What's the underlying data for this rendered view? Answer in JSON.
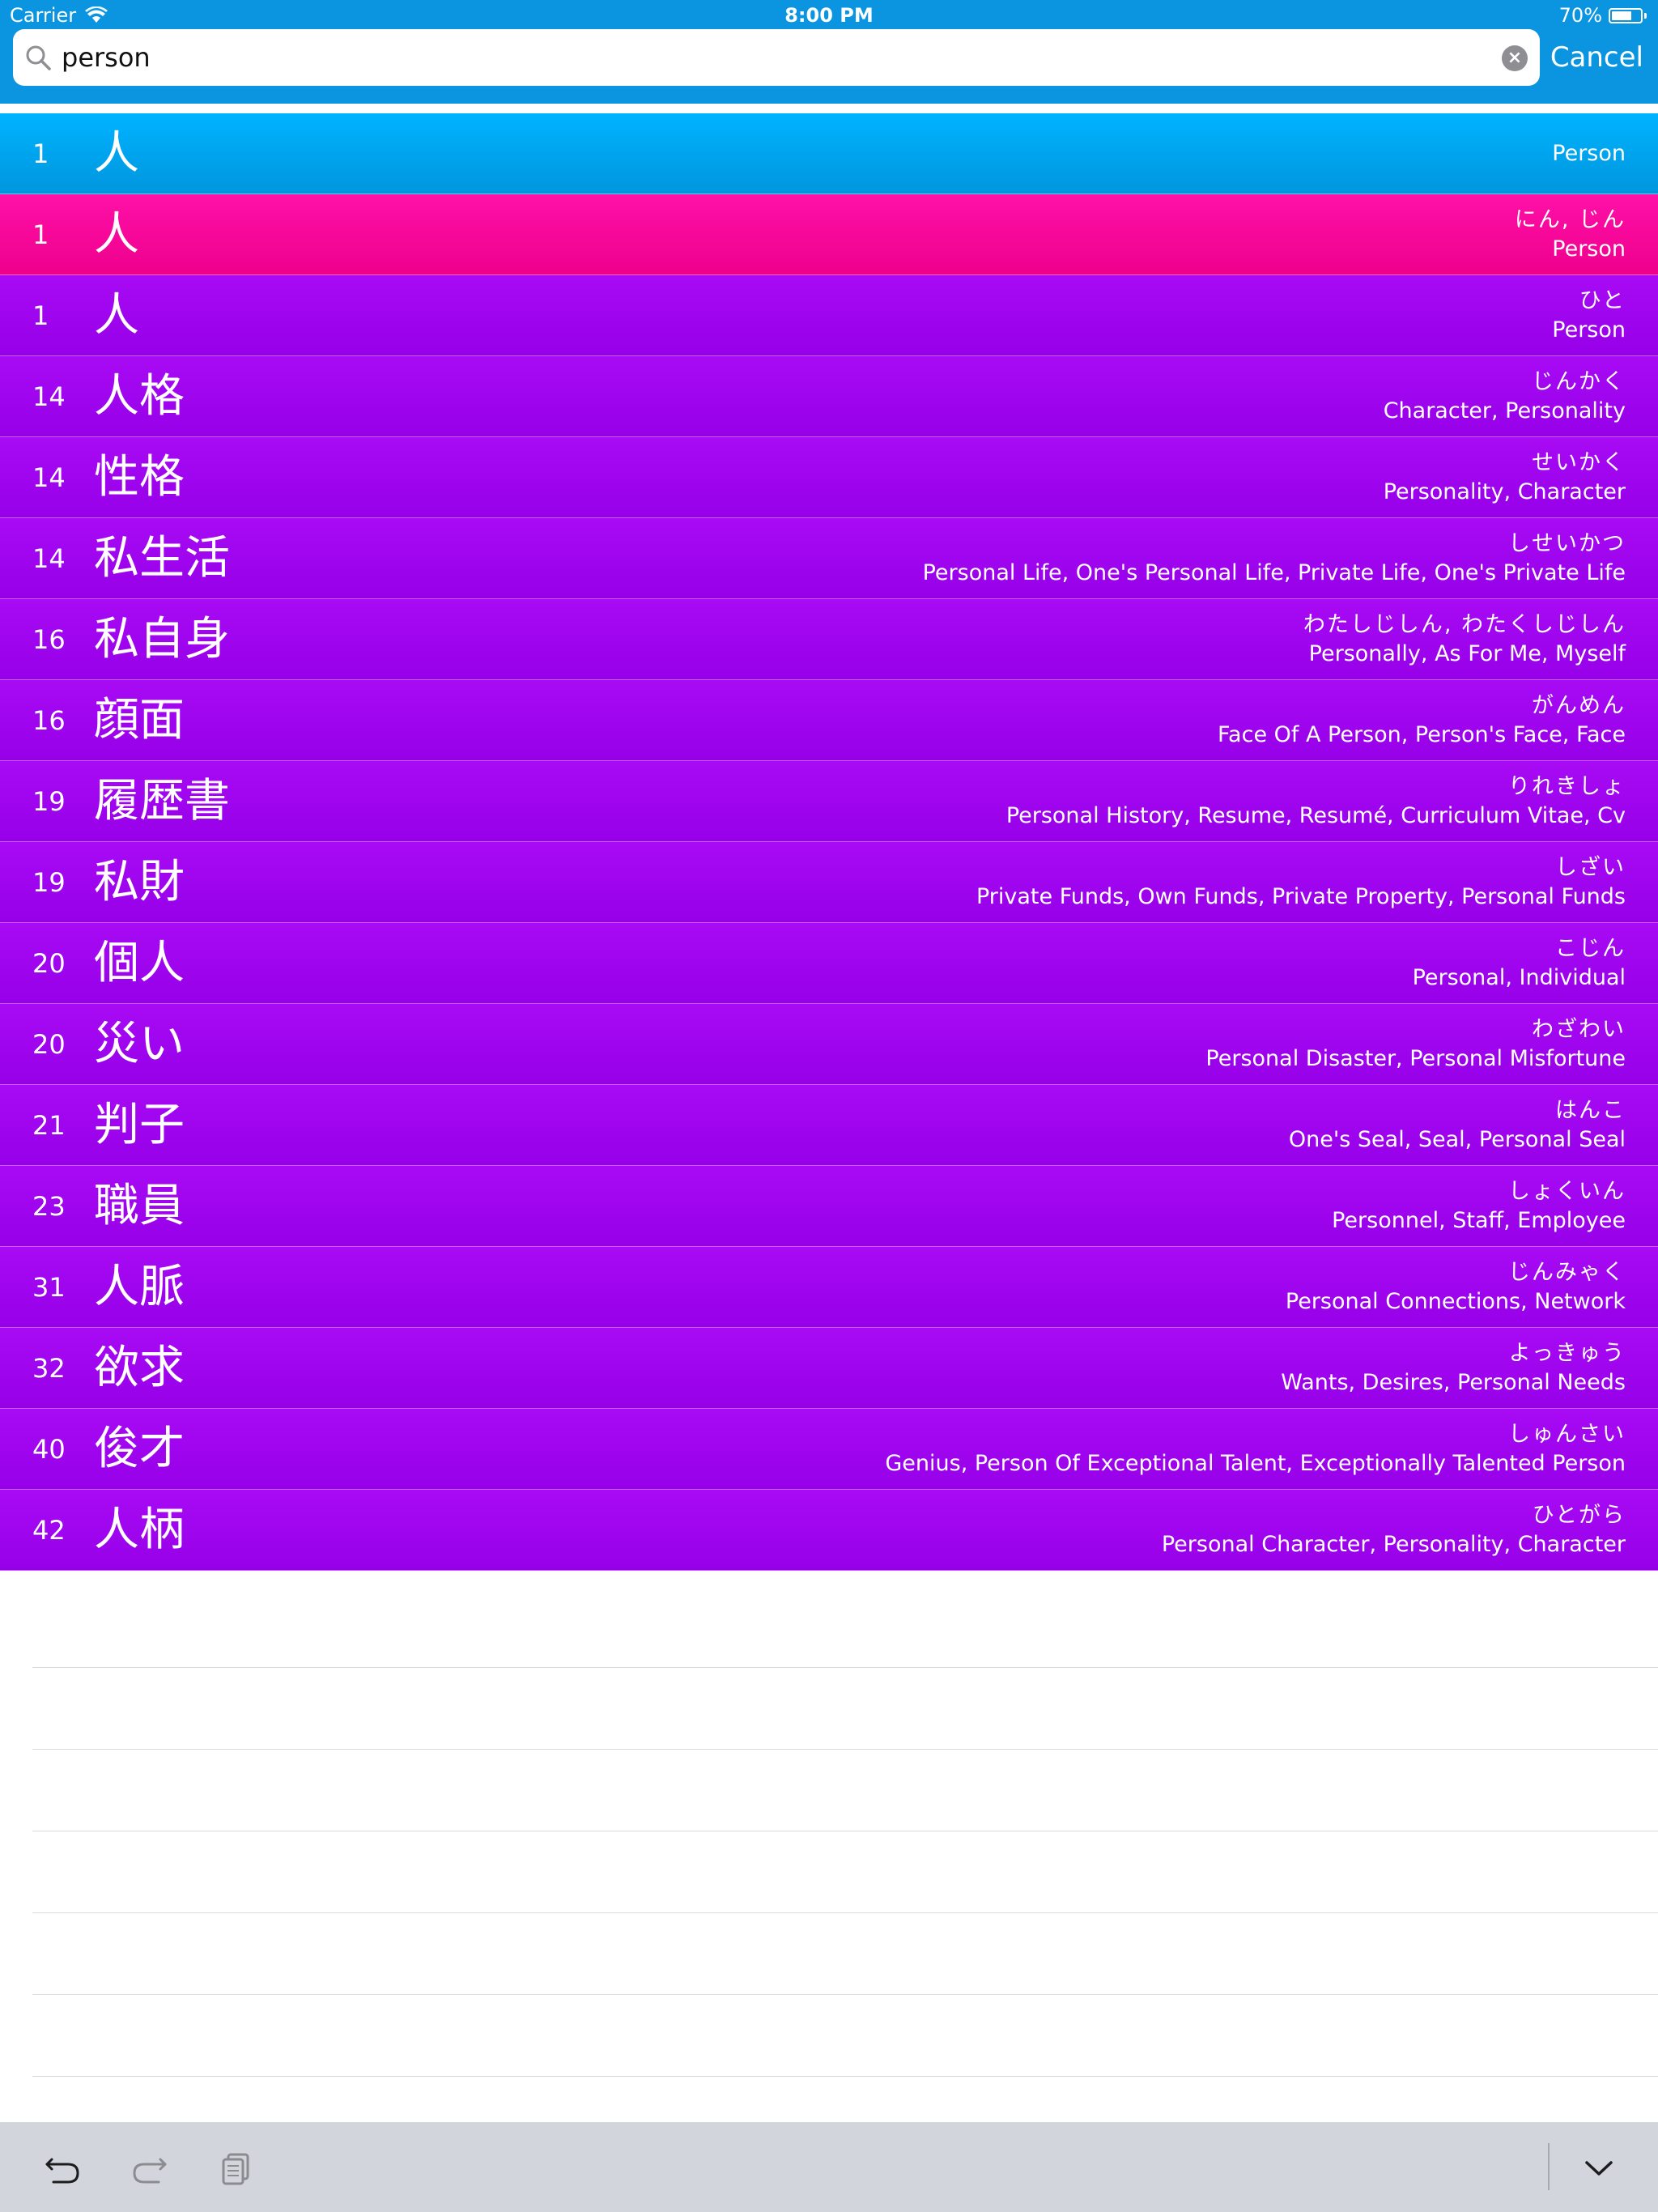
{
  "status_bar": {
    "carrier": "Carrier",
    "time": "8:00 PM",
    "battery": "70%",
    "battery_level": 0.7
  },
  "search": {
    "value": "person",
    "cancel_label": "Cancel"
  },
  "results": [
    {
      "level": "1",
      "word": "人",
      "reading": "",
      "meaning": "Person",
      "style": "blue"
    },
    {
      "level": "1",
      "word": "人",
      "reading": "にん, じん",
      "meaning": "Person",
      "style": "pink"
    },
    {
      "level": "1",
      "word": "人",
      "reading": "ひと",
      "meaning": "Person",
      "style": "purple"
    },
    {
      "level": "14",
      "word": "人格",
      "reading": "じんかく",
      "meaning": "Character, Personality",
      "style": "purple"
    },
    {
      "level": "14",
      "word": "性格",
      "reading": "せいかく",
      "meaning": "Personality, Character",
      "style": "purple"
    },
    {
      "level": "14",
      "word": "私生活",
      "reading": "しせいかつ",
      "meaning": "Personal Life, One's Personal Life, Private Life, One's Private Life",
      "style": "purple"
    },
    {
      "level": "16",
      "word": "私自身",
      "reading": "わたしじしん, わたくしじしん",
      "meaning": "Personally, As For Me, Myself",
      "style": "purple"
    },
    {
      "level": "16",
      "word": "顔面",
      "reading": "がんめん",
      "meaning": "Face Of A Person, Person's Face, Face",
      "style": "purple"
    },
    {
      "level": "19",
      "word": "履歴書",
      "reading": "りれきしょ",
      "meaning": "Personal History, Resume, Resumé, Curriculum Vitae, Cv",
      "style": "purple"
    },
    {
      "level": "19",
      "word": "私財",
      "reading": "しざい",
      "meaning": "Private Funds, Own Funds, Private Property, Personal Funds",
      "style": "purple"
    },
    {
      "level": "20",
      "word": "個人",
      "reading": "こじん",
      "meaning": "Personal, Individual",
      "style": "purple"
    },
    {
      "level": "20",
      "word": "災い",
      "reading": "わざわい",
      "meaning": "Personal Disaster, Personal Misfortune",
      "style": "purple"
    },
    {
      "level": "21",
      "word": "判子",
      "reading": "はんこ",
      "meaning": "One's Seal, Seal, Personal Seal",
      "style": "purple"
    },
    {
      "level": "23",
      "word": "職員",
      "reading": "しょくいん",
      "meaning": "Personnel, Staff, Employee",
      "style": "purple"
    },
    {
      "level": "31",
      "word": "人脈",
      "reading": "じんみゃく",
      "meaning": "Personal Connections, Network",
      "style": "purple"
    },
    {
      "level": "32",
      "word": "欲求",
      "reading": "よっきゅう",
      "meaning": "Wants, Desires, Personal Needs",
      "style": "purple"
    },
    {
      "level": "40",
      "word": "俊才",
      "reading": "しゅんさい",
      "meaning": "Genius, Person Of Exceptional Talent, Exceptionally Talented Person",
      "style": "purple"
    },
    {
      "level": "42",
      "word": "人柄",
      "reading": "ひとがら",
      "meaning": "Personal Character, Personality, Character",
      "style": "purple"
    }
  ],
  "toolbar": {
    "icons": [
      "undo-icon",
      "redo-icon",
      "clipboard-icon",
      "chevron-down-icon"
    ]
  },
  "colors": {
    "header": "#0b95e0",
    "row_blue": "#00a6f2",
    "row_pink": "#f7009a",
    "row_purple": "#a000ee",
    "toolbar": "#d2d5db"
  }
}
